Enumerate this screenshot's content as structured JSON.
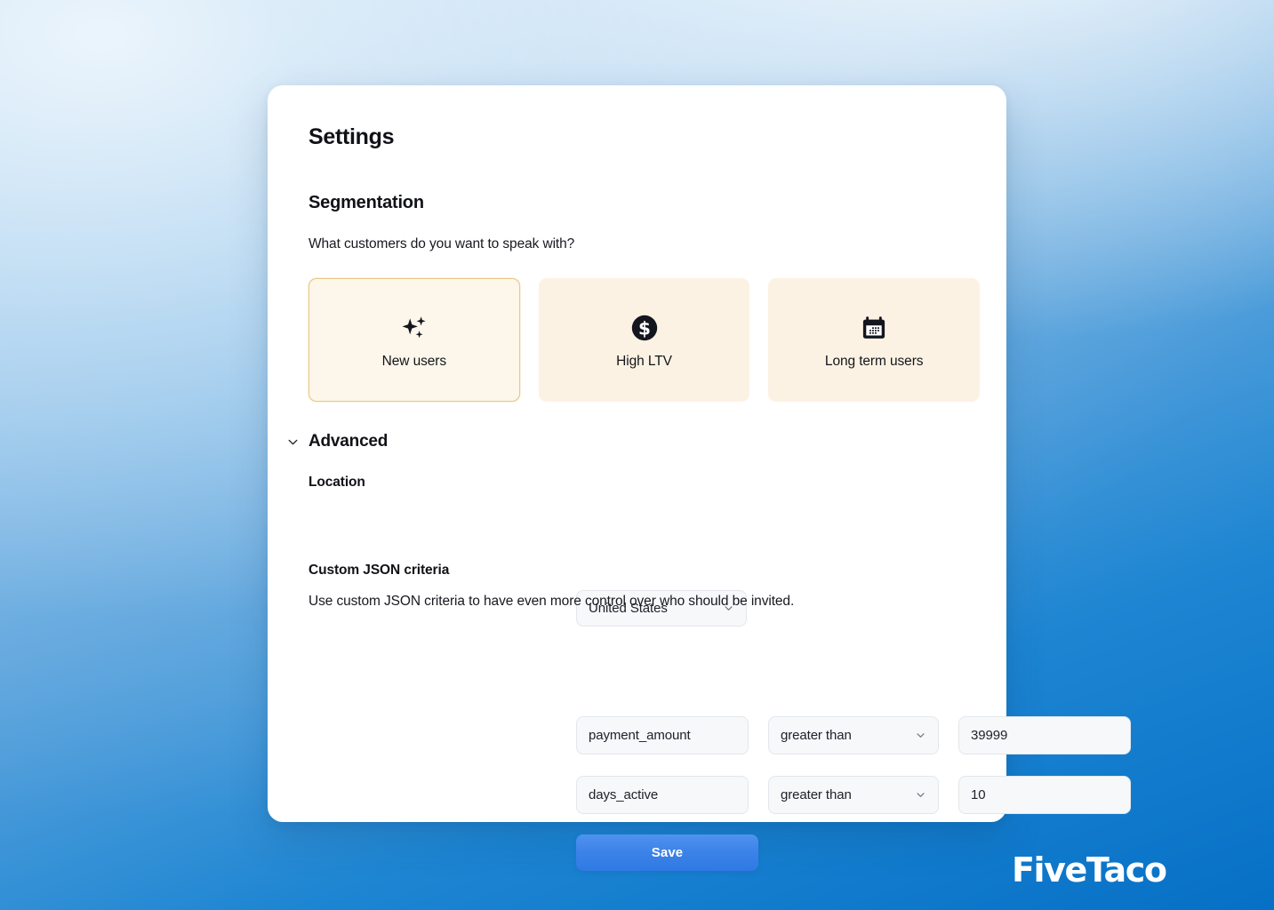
{
  "card": {
    "title": "Settings",
    "segmentation": {
      "heading": "Segmentation",
      "question": "What customers do you want to speak with?",
      "options": [
        {
          "label": "New users",
          "icon": "sparkles-icon",
          "selected": true
        },
        {
          "label": "High LTV",
          "icon": "dollar-circle-icon",
          "selected": false
        },
        {
          "label": "Long term users",
          "icon": "calendar-icon",
          "selected": false
        }
      ]
    },
    "advanced": {
      "label": "Advanced",
      "expanded": true,
      "chevron_icon": "chevron-down-icon",
      "location": {
        "label": "Location",
        "value": "United States",
        "chevron_icon": "chevron-down-icon"
      },
      "custom_json": {
        "label": "Custom JSON criteria",
        "help": "Use custom JSON criteria to have even more control over who should be invited.",
        "rows": [
          {
            "field": "payment_amount",
            "operator": "greater than",
            "value": "39999"
          },
          {
            "field": "days_active",
            "operator": "greater than",
            "value": "10"
          }
        ]
      }
    },
    "save_label": "Save"
  },
  "brand": {
    "name": "FiveTaco"
  },
  "colors": {
    "accent_blue": "#3b82e8",
    "card_cream": "#FCF2E3",
    "card_cream_selected": "#FDF6EA",
    "card_border_selected": "#E8CB83",
    "background_blue": "#0670C6",
    "input_bg": "#F6F8FA",
    "text_dark": "#111217"
  }
}
